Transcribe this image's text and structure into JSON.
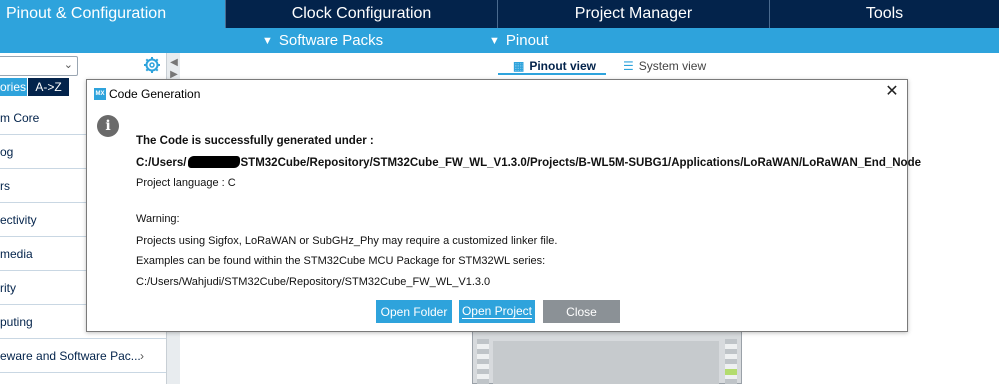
{
  "top_tabs": [
    {
      "label": "Pinout & Configuration",
      "active": true
    },
    {
      "label": "Clock Configuration",
      "active": false
    },
    {
      "label": "Project Manager",
      "active": false
    },
    {
      "label": "Tools",
      "active": false
    }
  ],
  "sub_bar": {
    "items": [
      {
        "label": "Software Packs",
        "icon": "chevron-down-icon"
      },
      {
        "label": "Pinout",
        "icon": "chevron-down-icon"
      }
    ]
  },
  "left_panel": {
    "sort_tabs": [
      "ories",
      "A->Z"
    ],
    "categories": [
      "m Core",
      "og",
      "rs",
      "ectivity",
      "media",
      "rity",
      "puting",
      "eware and Software Pac..."
    ]
  },
  "view_tabs": [
    {
      "label": "Pinout view",
      "icon": "chip-icon",
      "active": true
    },
    {
      "label": "System view",
      "icon": "list-icon",
      "active": false
    }
  ],
  "dialog": {
    "title": "Code Generation",
    "icon_text": "MX",
    "info_glyph": "i",
    "close_glyph": "✕",
    "heading": "The Code is successfully generated under :",
    "path_prefix": "C:/Users/",
    "path_suffix": "STM32Cube/Repository/STM32Cube_FW_WL_V1.3.0/Projects/B-WL5M-SUBG1/Applications/LoRaWAN/LoRaWAN_End_Node",
    "language": "Project language : C",
    "warning": "Warning:",
    "warning_line1": "Projects using Sigfox, LoRaWAN or SubGHz_Phy may require a customized linker file.",
    "warning_line2": "Examples can be found within the STM32Cube MCU Package for STM32WL series:",
    "warning_line3": "C:/Users/Wahjudi/STM32Cube/Repository/STM32Cube_FW_WL_V1.3.0",
    "buttons": {
      "open_folder": "Open Folder",
      "open_project": "Open Project",
      "close": "Close"
    }
  },
  "colors": {
    "navy": "#03234b",
    "accent": "#2ea3dc",
    "close_button": "#8b9196"
  }
}
